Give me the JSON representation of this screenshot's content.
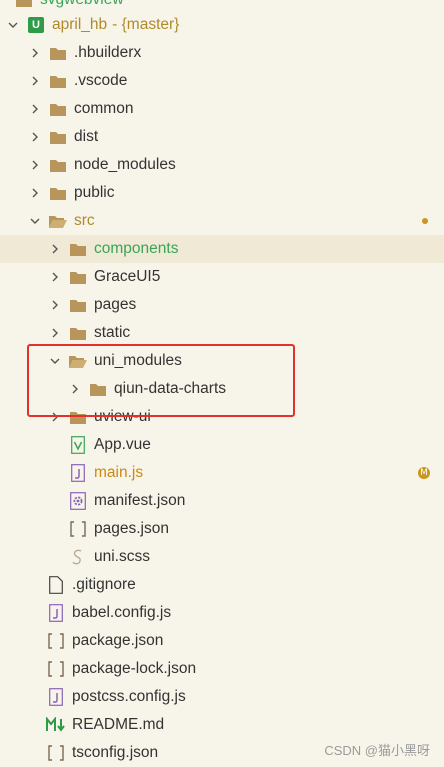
{
  "top_cut": "svgwebview",
  "project": {
    "name": "april_hb",
    "branch": "- {master}"
  },
  "items": [
    {
      "label": "svgwebview"
    },
    {
      "label": ".hbuilderx"
    },
    {
      "label": ".vscode"
    },
    {
      "label": "common"
    },
    {
      "label": "dist"
    },
    {
      "label": "node_modules"
    },
    {
      "label": "public"
    },
    {
      "label": "src"
    },
    {
      "label": "components"
    },
    {
      "label": "GraceUI5"
    },
    {
      "label": "pages"
    },
    {
      "label": "static"
    },
    {
      "label": "uni_modules"
    },
    {
      "label": "qiun-data-charts"
    },
    {
      "label": "uview-ui"
    },
    {
      "label": "App.vue"
    },
    {
      "label": "main.js"
    },
    {
      "label": "manifest.json"
    },
    {
      "label": "pages.json"
    },
    {
      "label": "uni.scss"
    },
    {
      "label": ".gitignore"
    },
    {
      "label": "babel.config.js"
    },
    {
      "label": "package.json"
    },
    {
      "label": "package-lock.json"
    },
    {
      "label": "postcss.config.js"
    },
    {
      "label": "README.md"
    },
    {
      "label": "tsconfig.json"
    }
  ],
  "modified_badge": "M",
  "watermark": "CSDN @猫小黑呀",
  "colors": {
    "folder": "#b8955a",
    "accent_green": "#3aa556",
    "highlight_box": "#e3302b",
    "modified": "#c9971d"
  }
}
